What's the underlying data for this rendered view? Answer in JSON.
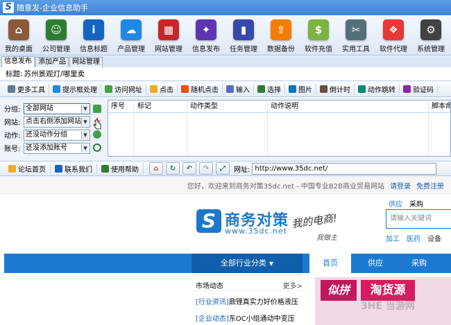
{
  "app": {
    "title": "随意发-企业信息助手",
    "logo_letter": "S"
  },
  "toolbar": [
    {
      "label": "我的桌面",
      "icon": "house-icon",
      "color": "#8a5a3a"
    },
    {
      "label": "公司管理",
      "icon": "people-icon",
      "color": "#2e7d32"
    },
    {
      "label": "信息标题",
      "icon": "info-icon",
      "color": "#1565c0"
    },
    {
      "label": "产品管理",
      "icon": "cloud-icon",
      "color": "#1e88e5"
    },
    {
      "label": "网站管理",
      "icon": "building-icon",
      "color": "#c62828"
    },
    {
      "label": "信息发布",
      "icon": "magic-wand-icon",
      "color": "#5e35b1"
    },
    {
      "label": "任务管理",
      "icon": "bar-chart-icon",
      "color": "#3949ab"
    },
    {
      "label": "数据备份",
      "icon": "upload-icon",
      "color": "#f57c00"
    },
    {
      "label": "软件充值",
      "icon": "coins-icon",
      "color": "#7cb342"
    },
    {
      "label": "实用工具",
      "icon": "tools-icon",
      "color": "#546e7a"
    },
    {
      "label": "软件代理",
      "icon": "gift-icon",
      "color": "#e53935"
    },
    {
      "label": "系统管理",
      "icon": "gear-icon",
      "color": "#424242"
    }
  ],
  "tabs": [
    "信息发布",
    "添加产品",
    "网站管理"
  ],
  "title_field": {
    "label": "标题:",
    "value": "苏州景观灯/哪里卖"
  },
  "action_bar": [
    {
      "label": "更多工具",
      "icon": "tools-icon",
      "color": "#607d8b"
    },
    {
      "label": "提示框处理",
      "icon": "dialog-icon",
      "color": "#1e88e5"
    },
    {
      "label": "访问网址",
      "icon": "globe-icon",
      "color": "#43a047"
    },
    {
      "label": "点击",
      "icon": "hand-icon",
      "color": "#f9a825"
    },
    {
      "label": "随机点击",
      "icon": "random-icon",
      "color": "#e65100"
    },
    {
      "label": "输入",
      "icon": "keyboard-icon",
      "color": "#5c6bc0"
    },
    {
      "label": "选择",
      "icon": "checkbox-icon",
      "color": "#2e7d32"
    },
    {
      "label": "图片",
      "icon": "image-icon",
      "color": "#0277bd"
    },
    {
      "label": "倒计时",
      "icon": "clock-icon",
      "color": "#6d4c41"
    },
    {
      "label": "动作跳转",
      "icon": "jump-icon",
      "color": "#00897b"
    },
    {
      "label": "验证码",
      "icon": "captcha-icon",
      "color": "#8e24aa"
    }
  ],
  "form": {
    "group": {
      "label": "分组:",
      "value": "全部网站"
    },
    "site": {
      "label": "网站:",
      "value": "点击右侧添加网站"
    },
    "action": {
      "label": "动作:",
      "value": "还没动作分组"
    },
    "account": {
      "label": "账号:",
      "value": "还没添加账号"
    }
  },
  "grid": {
    "headers": [
      "序号",
      "标记",
      "动作类型",
      "动作说明",
      "脚本命令"
    ]
  },
  "navbar": {
    "links": [
      {
        "label": "论坛首页",
        "icon": "speech-bubble-icon",
        "color": "#f9a825"
      },
      {
        "label": "联系我们",
        "icon": "contact-card-icon",
        "color": "#1565c0"
      },
      {
        "label": "使用帮助",
        "icon": "question-icon",
        "color": "#2e7d32"
      }
    ],
    "url_label": "网址:",
    "url": "http://www.35dc.net/"
  },
  "website": {
    "welcome": "您好，欢迎来到商务对策35dc.net - 中国专业B2B商业贸易网站",
    "login": "请登录",
    "register": "免费注册",
    "logo_letter": "S",
    "brand": "商务对策",
    "brand_url": "www.35dc.net",
    "slogan": "我的电商!",
    "slogan2": "我做主",
    "search_tabs": [
      "供应",
      "采购"
    ],
    "search_placeholder": "请输入关键词",
    "hot": [
      "加工",
      "医药",
      "设备"
    ],
    "categories": "全部行业分类",
    "nav": [
      "首页",
      "供应",
      "采购"
    ],
    "news_title": "市场动态",
    "news_more": "更多>",
    "news": [
      {
        "tag": "[行业资讯]",
        "text": "鼎锂真实力好价格液压"
      },
      {
        "tag": "[企业动态]",
        "text": "东OC小组通动中变压"
      }
    ],
    "banner": [
      "似拼",
      "淘货源"
    ],
    "watermark": "3HE 当游网"
  }
}
